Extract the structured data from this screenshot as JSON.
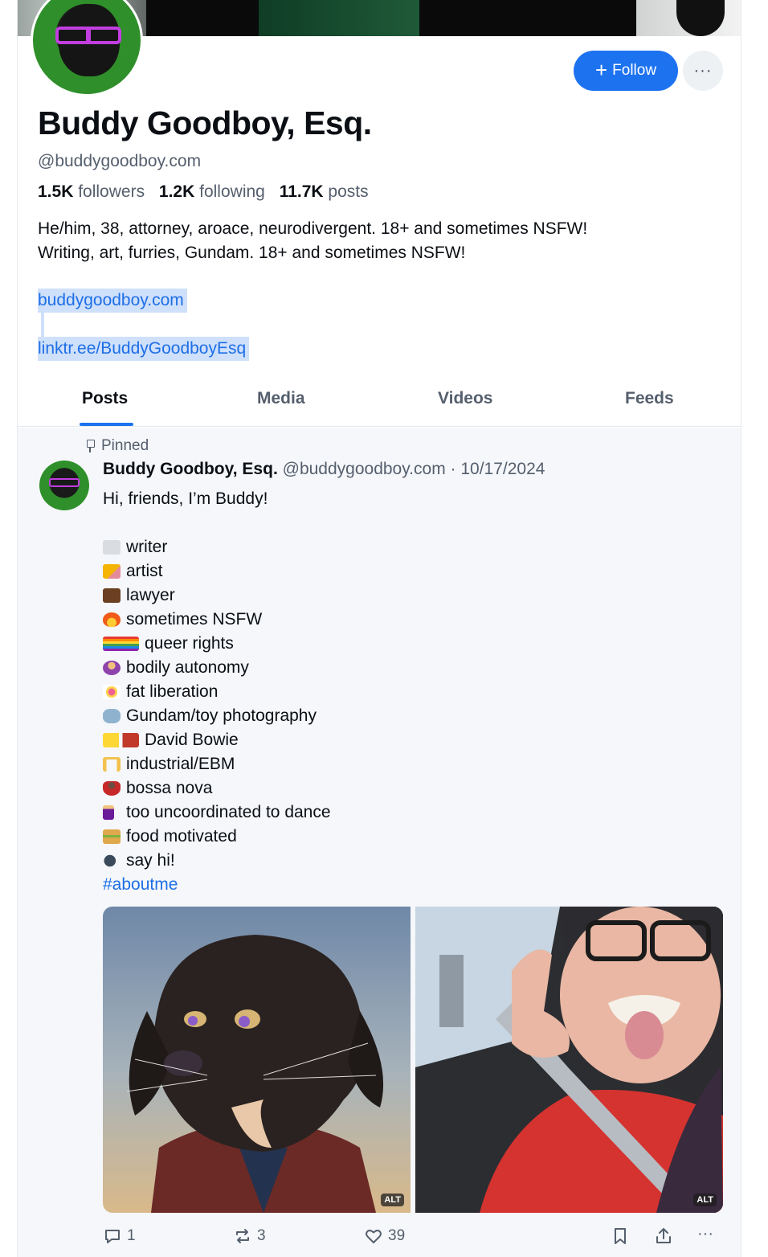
{
  "profile": {
    "display_name": "Buddy Goodboy, Esq.",
    "handle": "@buddygoodboy.com",
    "follow_label": "Follow",
    "more_label": "···",
    "stats": {
      "followers_count": "1.5K",
      "followers_label": "followers",
      "following_count": "1.2K",
      "following_label": "following",
      "posts_count": "11.7K",
      "posts_label": "posts"
    },
    "bio_line1": "He/him, 38, attorney, aroace, neurodivergent. 18+ and sometimes NSFW!",
    "bio_line2": "Writing, art, furries, Gundam. 18+ and sometimes NSFW!",
    "link1": "buddygoodboy.com",
    "link2": "linktr.ee/BuddyGoodboyEsq"
  },
  "tabs": [
    "Posts",
    "Media",
    "Videos",
    "Feeds"
  ],
  "colors": {
    "accent": "#1d72f0",
    "link": "#1d6fe6",
    "selection": "#cfe0fb",
    "muted": "#555f6d",
    "feed_bg": "#f5f7fa"
  },
  "post": {
    "pinned_label": "Pinned",
    "author_name": "Buddy Goodboy, Esq.",
    "author_handle": "@buddygoodboy.com",
    "separator": " · ",
    "date": "10/17/2024",
    "greeting": "Hi, friends, I’m Buddy!",
    "items": [
      {
        "icon": "keyboard-emoji",
        "text": "writer"
      },
      {
        "icon": "pencil-emoji",
        "text": "artist"
      },
      {
        "icon": "briefcase-emoji",
        "text": "lawyer"
      },
      {
        "icon": "fire-emoji",
        "text": "sometimes NSFW"
      },
      {
        "icon": "rainbow-trans-flags-emoji",
        "text": "queer rights"
      },
      {
        "icon": "woman-gesturing-emoji",
        "text": "bodily autonomy"
      },
      {
        "icon": "confetti-ball-emoji",
        "text": "fat liberation"
      },
      {
        "icon": "robot-emoji",
        "text": "Gundam/toy photography"
      },
      {
        "icon": "lightning-guitar-emoji",
        "text": "David Bowie"
      },
      {
        "icon": "construction-crane-emoji",
        "text": "industrial/EBM"
      },
      {
        "icon": "dancer-emoji",
        "text": "bossa nova"
      },
      {
        "icon": "man-dancing-emoji",
        "text": "too uncoordinated to dance"
      },
      {
        "icon": "sandwich-emoji",
        "text": "food motivated"
      },
      {
        "icon": "speaking-head-emoji",
        "text": "say hi!"
      }
    ],
    "hashtag": "#aboutme",
    "images": [
      {
        "icon": "dog-illustration-image",
        "alt_label": "ALT"
      },
      {
        "icon": "car-selfie-photo",
        "alt_label": "ALT"
      }
    ],
    "replies": "1",
    "reposts": "3",
    "likes": "39"
  }
}
